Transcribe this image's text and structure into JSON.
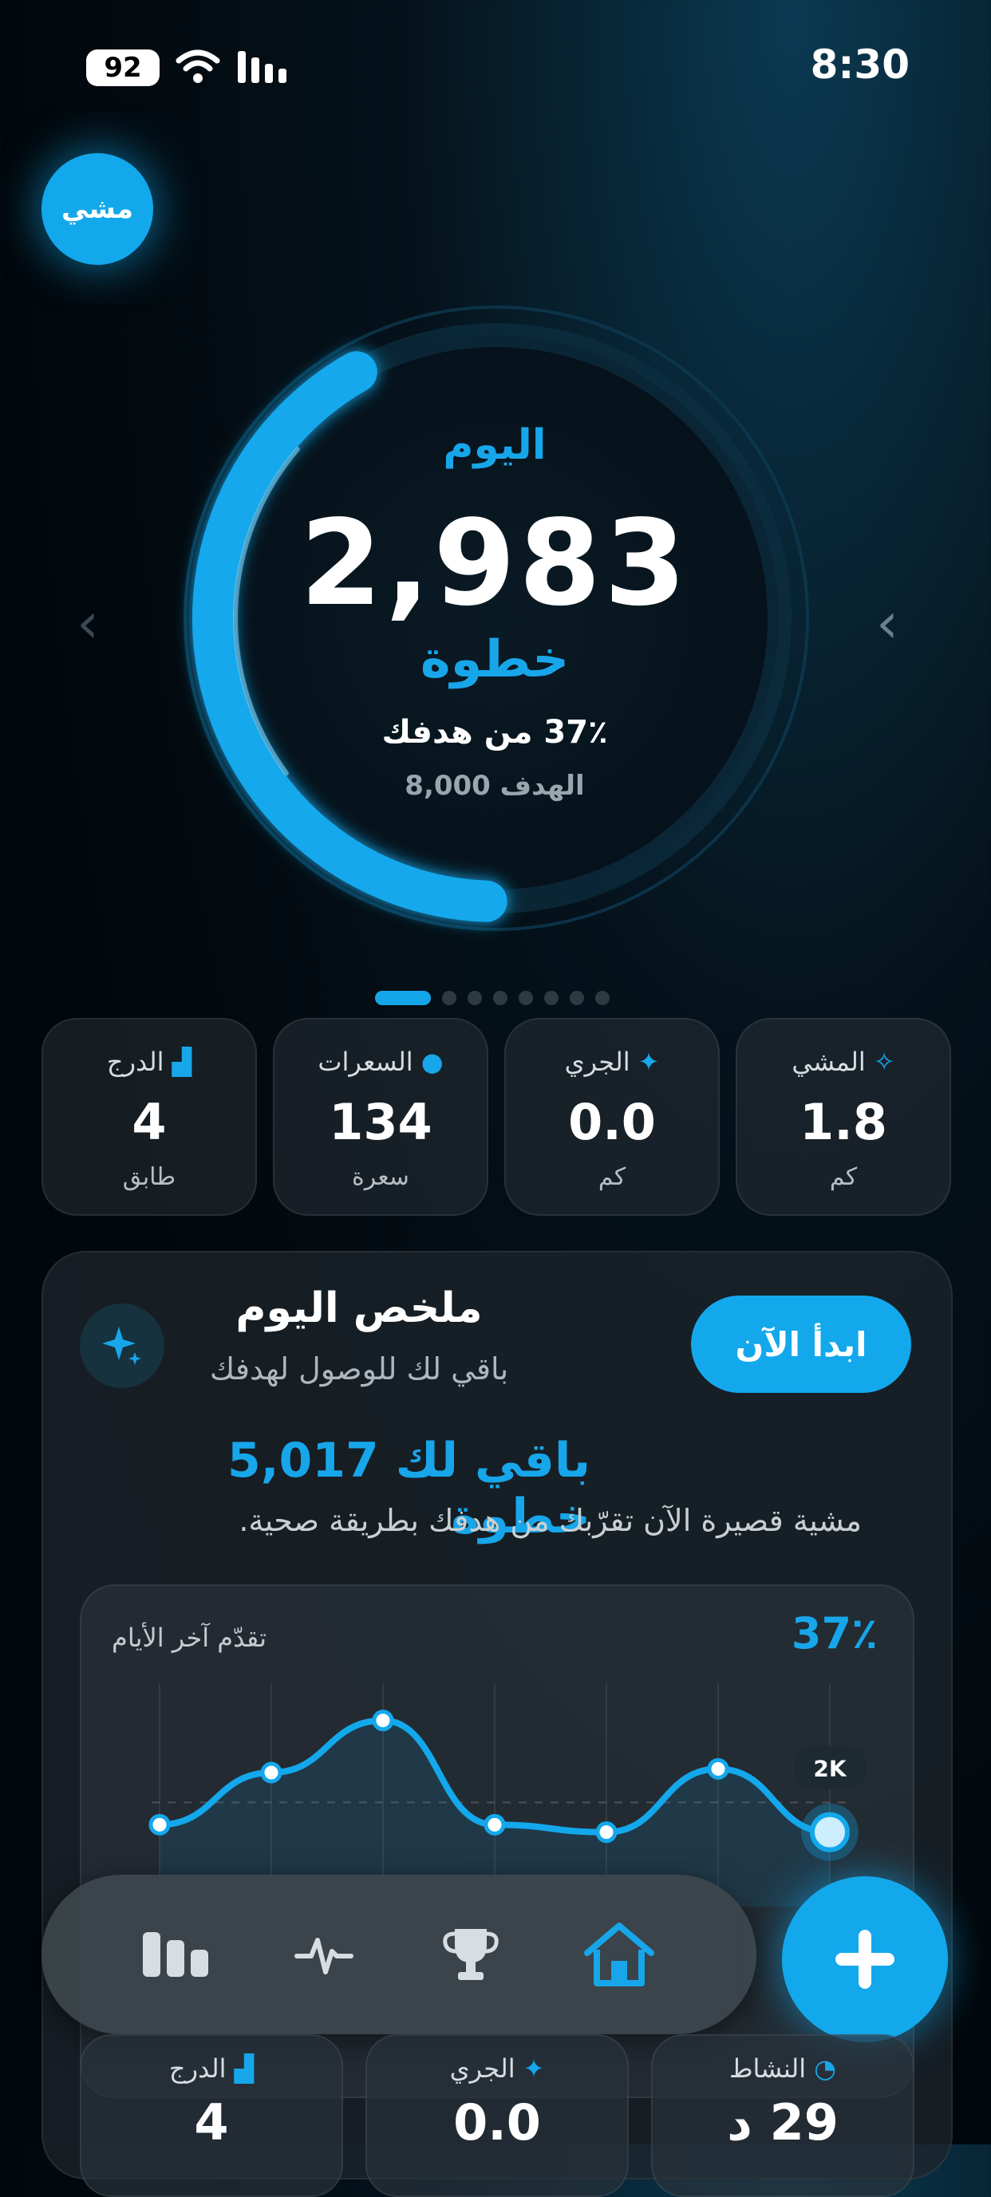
{
  "status_bar": {
    "time": "8:30",
    "battery": "92"
  },
  "mode_button": "مشي",
  "ring": {
    "label": "اليوم",
    "steps": "2,983",
    "unit": "خطوة",
    "percent_text": "37٪ من هدفك",
    "goal_text": "الهدف 8,000",
    "progress": 0.37
  },
  "pager": {
    "count": 8,
    "active": 0
  },
  "stats": [
    {
      "label": "المشي",
      "value": "1.8",
      "unit": "كم",
      "icon": "walk-icon"
    },
    {
      "label": "الجري",
      "value": "0.0",
      "unit": "كم",
      "icon": "run-icon"
    },
    {
      "label": "السعرات",
      "value": "134",
      "unit": "سعرة",
      "icon": "flame-icon"
    },
    {
      "label": "الدرج",
      "value": "4",
      "unit": "طابق",
      "icon": "stairs-icon"
    }
  ],
  "summary": {
    "title": "ملخص اليوم",
    "subtitle": "باقي لك للوصول لهدفك",
    "start_label": "ابدأ الآن",
    "remaining": "باقي لك 5,017 خطوة",
    "tip": "مشية قصيرة الآن تقرّبك من هدفك بطريقة صحية."
  },
  "chart": {
    "title": "تقدّم آخر الأيام",
    "percent": "37٪",
    "badge": "2K"
  },
  "chart_data": {
    "type": "line",
    "title": "تقدّم آخر الأيام",
    "x": [
      1,
      2,
      3,
      4,
      5,
      6,
      7
    ],
    "series": [
      {
        "values": [
          2.2,
          3.6,
          5.0,
          2.2,
          2.0,
          3.7,
          2.0
        ]
      }
    ],
    "ylim": [
      0,
      6
    ],
    "grid": true,
    "annotations": [
      "2K"
    ]
  },
  "nav": {
    "items": [
      "home-icon",
      "trophy-icon",
      "pulse-icon",
      "stats-icon"
    ],
    "active": "home-icon"
  },
  "lower_cards": [
    {
      "label": "النشاط",
      "value": "29 د",
      "icon": "timer-icon"
    },
    {
      "label": "الجري",
      "value": "0.0",
      "icon": "run-icon"
    },
    {
      "label": "الدرج",
      "value": "4",
      "icon": "stairs-icon"
    }
  ],
  "colors": {
    "accent": "#13a8ec",
    "background": "#02070b"
  }
}
